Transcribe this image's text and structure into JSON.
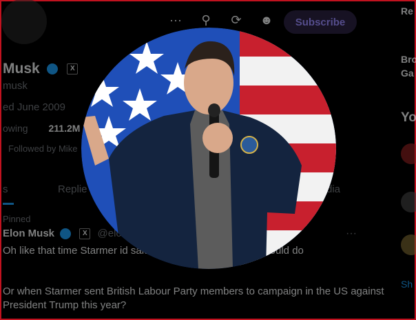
{
  "header": {
    "subscribe_label": "Subscribe"
  },
  "profile": {
    "name": "Musk",
    "handle": "musk",
    "joined": "ed June 2009",
    "following_label": "owing",
    "followers": "211.2M F",
    "followed_by": "Followed by Mike"
  },
  "tabs": {
    "posts": "s",
    "replies": "Replie",
    "media": "dia"
  },
  "post": {
    "pinned": "Pinned",
    "author": "Elon Musk",
    "handle": "@elo",
    "more": "···",
    "text1": "Oh like that time Starmer                                                                     id said the British government should do",
    "text2": "Or when Starmer sent British Labour Party members to campaign in the US against President Trump this year?"
  },
  "right_column": {
    "top": "Re",
    "trend_line1": "Bro",
    "trend_line2": "Ga",
    "section": "Yo",
    "show_more": "Sh"
  },
  "colors": {
    "accent": "#1d9bf0",
    "flag_blue": "#1f4fb8",
    "flag_red": "#c8202e"
  }
}
